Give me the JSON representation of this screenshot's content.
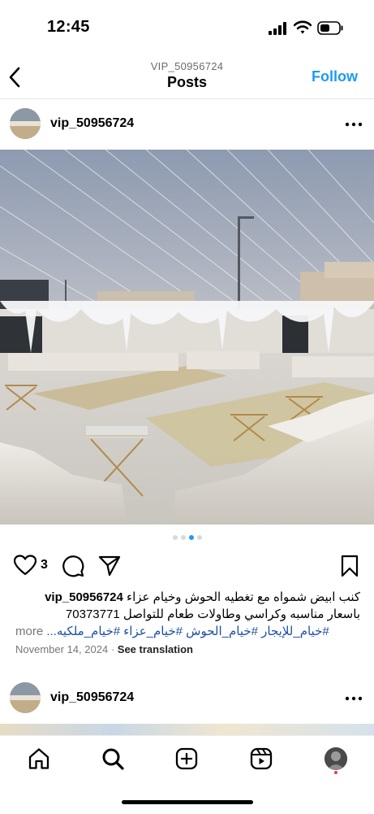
{
  "status_bar": {
    "time": "12:45",
    "icons": [
      "signal-icon",
      "wifi-icon",
      "battery-icon"
    ]
  },
  "nav": {
    "username": "VIP_50956724",
    "title": "Posts",
    "follow_label": "Follow",
    "back_icon": "chevron-left-icon"
  },
  "post": {
    "username": "vip_50956724",
    "carousel": {
      "count": 4,
      "active_index": 2
    },
    "likes": "3",
    "caption": {
      "line1_text": "كنب ابيض شمواه مع تغطيه الحوش وخيام عزاء",
      "line2": "باسعار مناسبه وكراسي وطاولات طعام للتواصل 70373771",
      "hashtags": "#خيام_للإيجار #خيام_الحوش #خيام_عزاء #خيام_ملكيه...",
      "more": "more"
    },
    "date": "November 14, 2024",
    "separator": "·",
    "see_translation": "See translation"
  },
  "next_post": {
    "username": "vip_50956724"
  },
  "tab_bar": {
    "items": [
      "home-icon",
      "search-icon",
      "create-icon",
      "reels-icon",
      "profile-avatar"
    ]
  },
  "colors": {
    "accent": "#1d9bf0",
    "hashtag": "#1d4fa1",
    "notification": "#ff3040"
  }
}
